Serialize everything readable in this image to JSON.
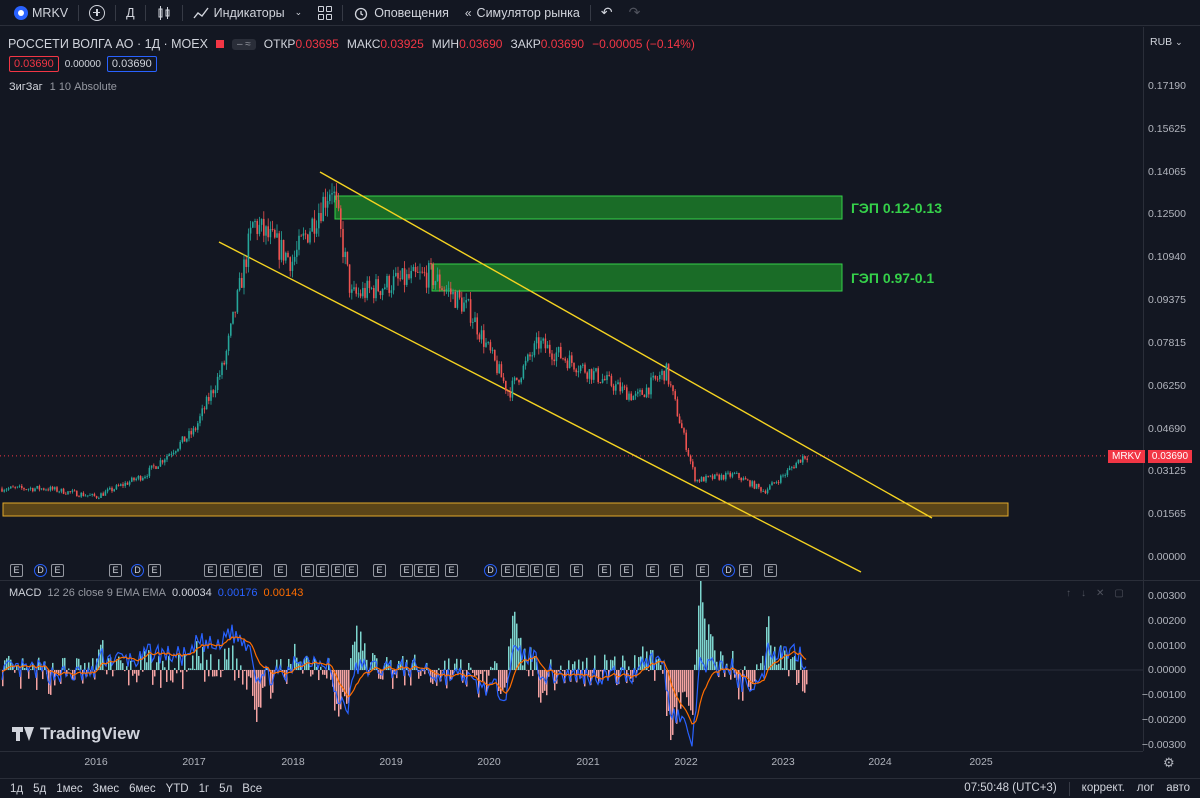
{
  "toolbar": {
    "symbol": "MRKV",
    "interval": "Д",
    "indicators": "Индикаторы",
    "alerts": "Оповещения",
    "replay": "Симулятор рынка"
  },
  "header": {
    "title": "РОССЕТИ ВОЛГА АО · 1Д · MOEX",
    "open_label": "ОТКР",
    "open": "0.03695",
    "high_label": "МАКС",
    "high": "0.03925",
    "low_label": "МИН",
    "low": "0.03690",
    "close_label": "ЗАКР",
    "close": "0.03690",
    "change": "−0.00005 (−0.14%)",
    "bid": "0.03690",
    "spread": "0.00000",
    "ask": "0.03690",
    "indicator1": "ЗигЗаг",
    "indicator1_params": "1 10 Absolute",
    "currency": "RUB"
  },
  "macd": {
    "label": "MACD",
    "params": "12 26 close 9 EMA EMA",
    "hist": "0.00034",
    "macd_val": "0.00176",
    "signal_val": "0.00143"
  },
  "annotations": {
    "gap1": "ГЭП 0.12-0.13",
    "gap2": "ГЭП 0.97-0.1",
    "price_tag_symbol": "MRKV",
    "price_tag_value": "0.03690"
  },
  "price_axis": [
    "0.17190",
    "0.15625",
    "0.14065",
    "0.12500",
    "0.10940",
    "0.09375",
    "0.07815",
    "0.06250",
    "0.04690",
    "0.03125",
    "0.01565",
    "0.00000"
  ],
  "macd_axis": [
    "0.00300",
    "0.00200",
    "0.00100",
    "0.00000",
    "−0.00100",
    "−0.00200",
    "−0.00300"
  ],
  "time_axis": [
    "2016",
    "2017",
    "2018",
    "2019",
    "2020",
    "2021",
    "2022",
    "2023",
    "2024",
    "2025"
  ],
  "bottom_bar": {
    "ranges": [
      "1д",
      "5д",
      "1мес",
      "3мес",
      "6мес",
      "YTD",
      "1г",
      "5л",
      "Все"
    ],
    "clock": "07:50:48 (UTC+3)",
    "adjust": "коррект.",
    "log": "лог",
    "auto": "авто"
  },
  "branding": "TradingView",
  "colors": {
    "background": "#131722",
    "bull": "#26a69a",
    "bear": "#ef5350",
    "channel": "#f5d321",
    "gap_zone": "#1e8a2a",
    "support_zone": "#7a5a14",
    "macd_line": "#2962ff",
    "signal_line": "#ff6d00",
    "accent": "#2962ff"
  },
  "chart_data": {
    "type": "line",
    "title": "РОССЕТИ ВОЛГА АО · 1Д · MOEX",
    "x": [
      2015.5,
      2016.0,
      2016.5,
      2017.0,
      2017.3,
      2017.6,
      2018.0,
      2018.4,
      2018.6,
      2019.0,
      2019.4,
      2019.8,
      2020.2,
      2020.5,
      2021.0,
      2021.5,
      2021.8,
      2022.1,
      2022.5,
      2022.8,
      2023.0,
      2023.2
    ],
    "values": [
      0.025,
      0.022,
      0.03,
      0.046,
      0.07,
      0.122,
      0.108,
      0.136,
      0.095,
      0.1,
      0.103,
      0.09,
      0.06,
      0.078,
      0.068,
      0.058,
      0.068,
      0.028,
      0.03,
      0.024,
      0.03,
      0.0369
    ],
    "ylim": [
      0.0,
      0.1719
    ],
    "xlabel": "",
    "ylabel": ""
  }
}
